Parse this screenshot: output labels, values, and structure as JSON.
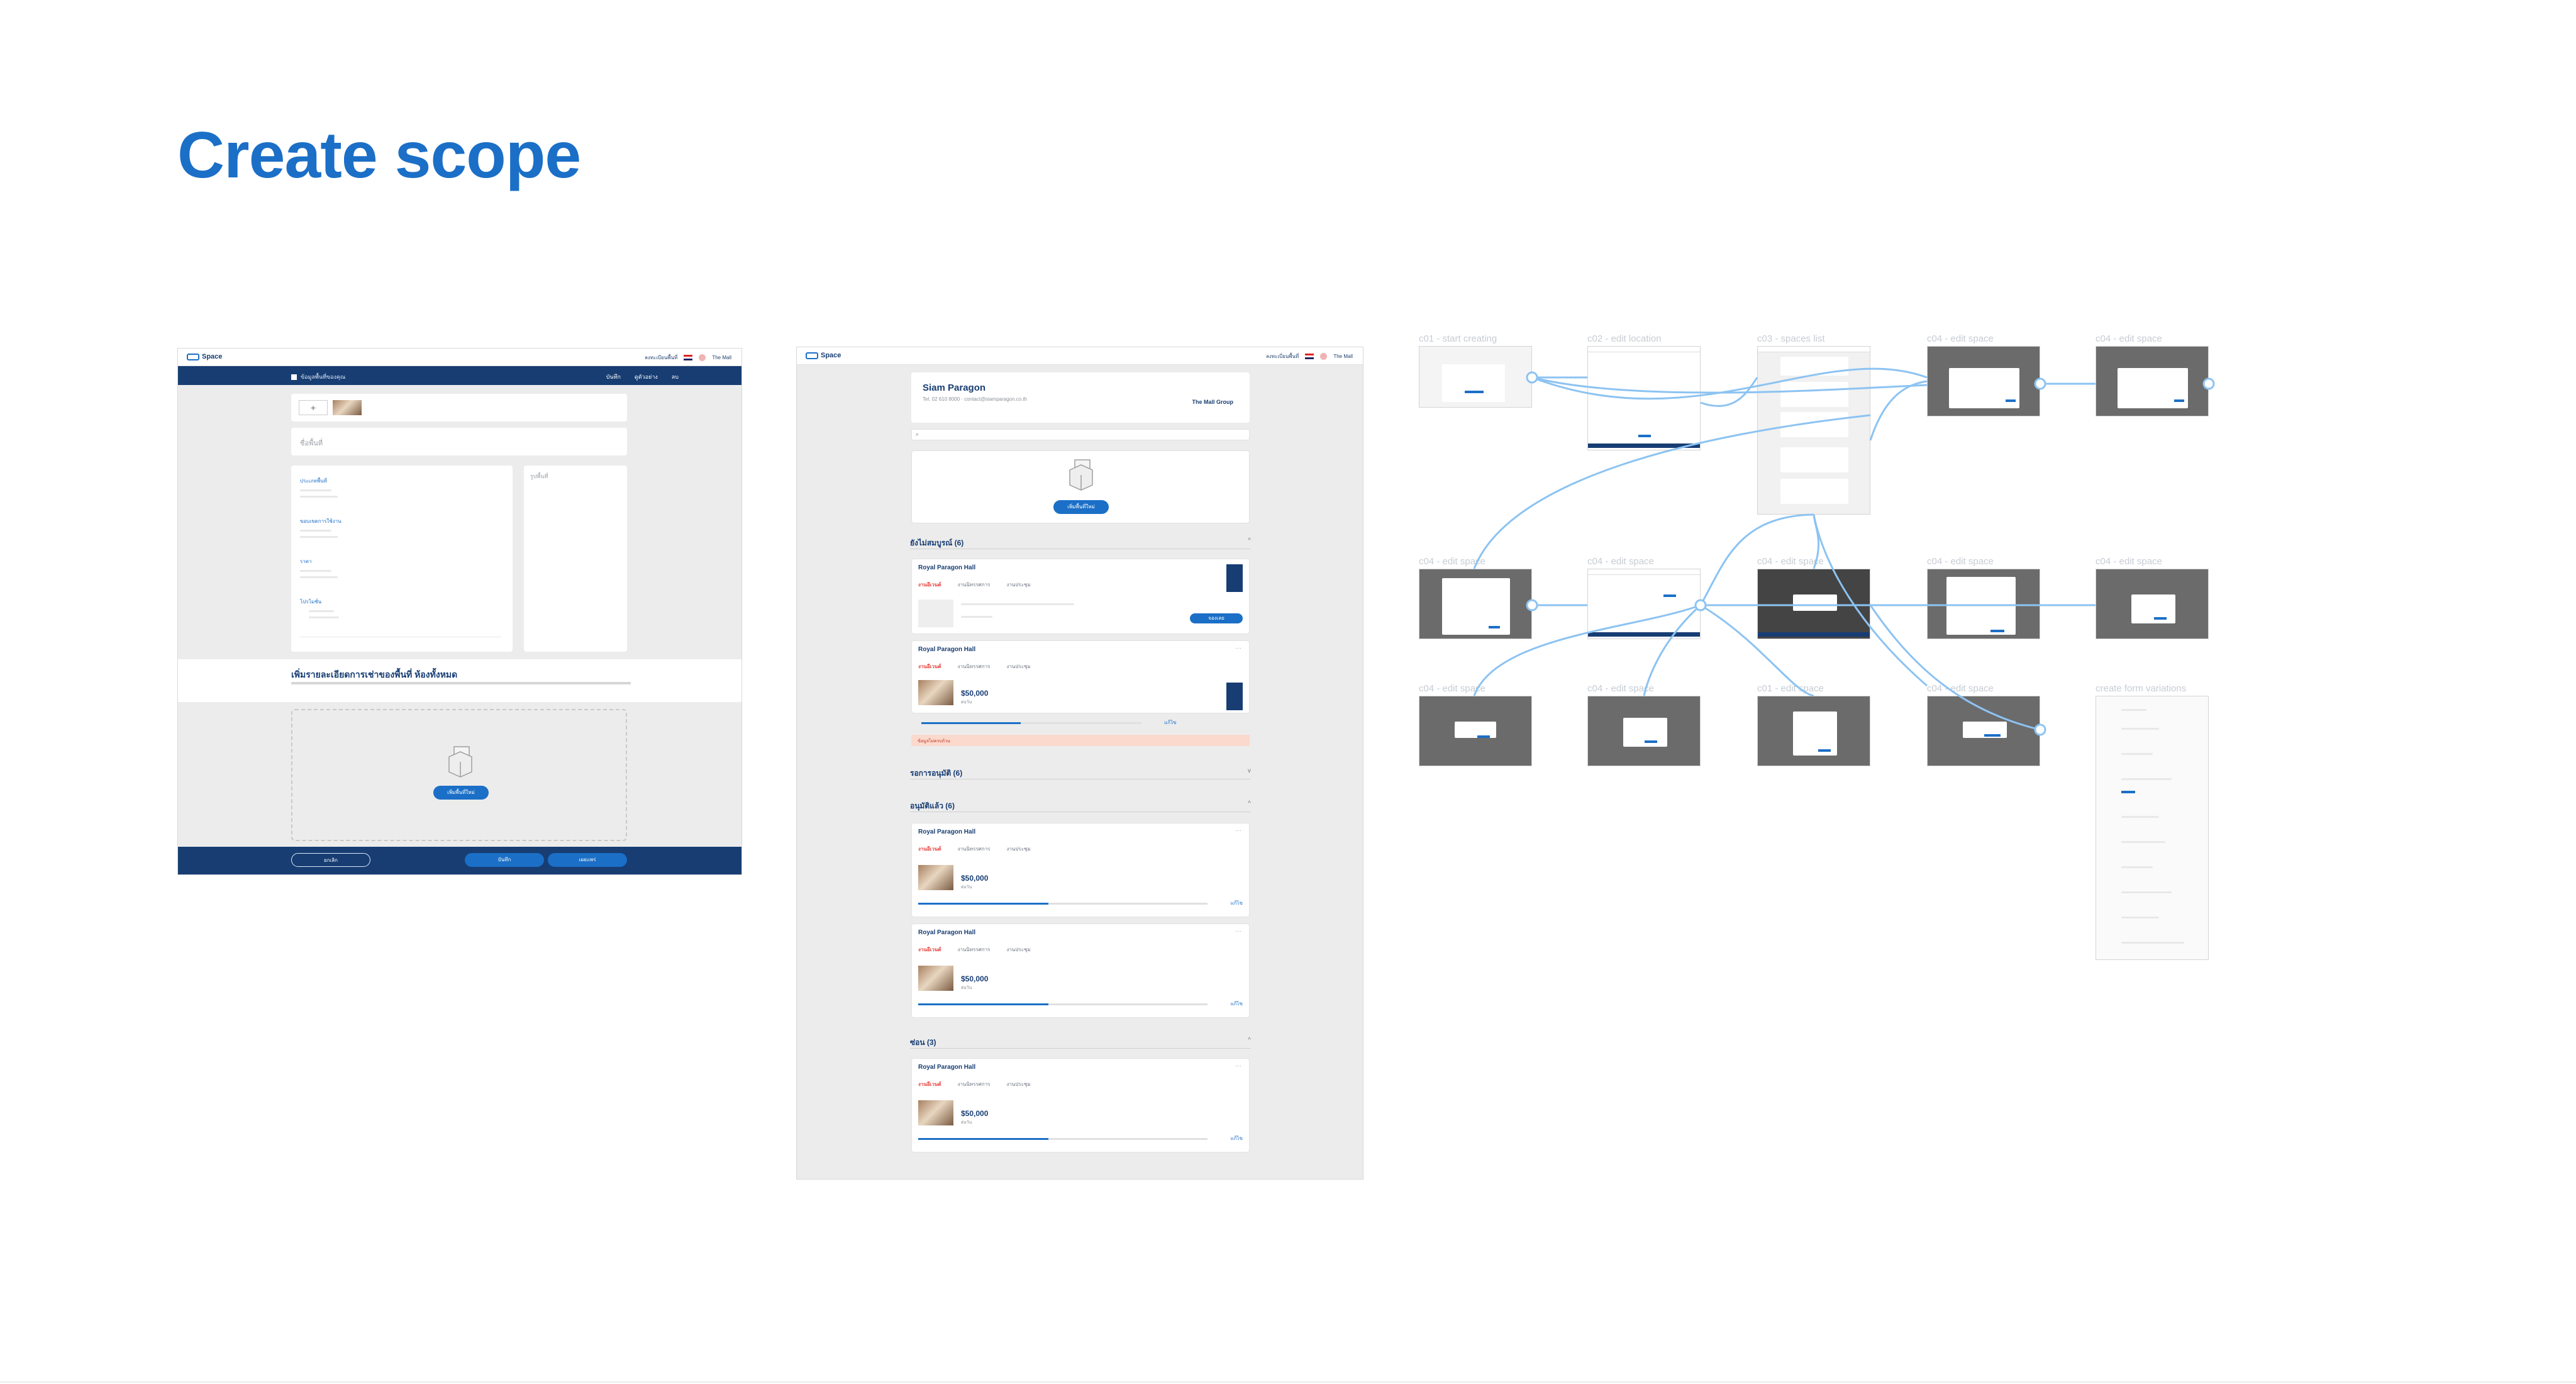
{
  "page": {
    "title": "Create scope"
  },
  "screen1": {
    "brand": "Space",
    "nav": {
      "link": "ลงทะเบียนพื้นที่",
      "user": "The Mall"
    },
    "bar": {
      "crumb": "ข้อมูลพื้นที่ของคุณ",
      "actions": [
        "บันทึก",
        "ดูตัวอย่าง",
        "ลบ"
      ]
    },
    "field_name": "ชื่อพื้นที่",
    "right_panel": "รูปพื้นที่",
    "sections": [
      "ประเภทพื้นที่",
      "ขอบเขตการใช้งาน",
      "ราคา",
      "โปรโมชั่น"
    ],
    "band_title": "เพิ่มรายละเอียดการเช่าของพื้นที่ ห้องทั้งหมด",
    "upload_button": "เพิ่มพื้นที่ใหม่",
    "footer": {
      "back": "ยกเลิก",
      "save": "บันทึก",
      "publish": "เผยแพร่"
    }
  },
  "screen2": {
    "brand": "Space",
    "nav": {
      "link": "ลงทะเบียนพื้นที่",
      "user": "The Mall"
    },
    "venue": {
      "name": "Siam Paragon",
      "meta": "Tel. 02 610 8000 · contact@siamparagon.co.th",
      "org": "The Mall Group"
    },
    "drop_button": "เพิ่มพื้นที่ใหม่",
    "groups": [
      {
        "title": "ยังไม่สมบูรณ์ (6)",
        "chev": "^"
      },
      {
        "title": "รอการอนุมัติ (6)",
        "chev": "v"
      },
      {
        "title": "อนุมัติแล้ว (6)",
        "chev": "^"
      },
      {
        "title": "ซ่อน (3)",
        "chev": "^"
      }
    ],
    "card": {
      "title": "Royal Paragon Hall",
      "tags": [
        "งานอีเวนต์",
        "งานนิทรรศการ",
        "งานประชุม"
      ],
      "price": "$50,000",
      "meta": "ต่อวัน",
      "edit": "แก้ไข",
      "book": "จองเลย",
      "dots": "···"
    },
    "warning": "ข้อมูลไม่ครบถ้วน"
  },
  "flow": {
    "labels": [
      "c01 - start creating",
      "c02 - edit location",
      "c03 - spaces list",
      "c04 - edit space",
      "c04 - edit space",
      "c04 - edit space",
      "c04 - edit space",
      "c04 - edit space",
      "c04 - edit space",
      "c04 - edit space",
      "c04 - edit space",
      "c04 - edit space",
      "c01 - edit space",
      "c04 - edit space",
      "create form variations"
    ]
  },
  "colors": {
    "accent": "#1b6fc7",
    "navy": "#173d73",
    "flow_line": "#8cc3f2"
  }
}
